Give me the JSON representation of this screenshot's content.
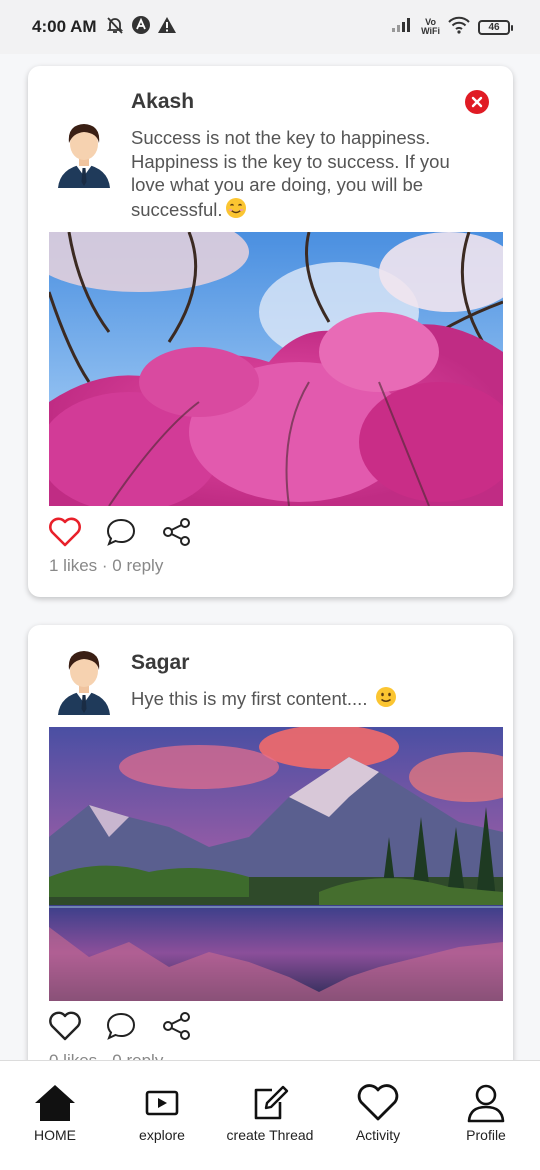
{
  "status": {
    "time": "4:00 AM",
    "wifi_label_top": "Vo",
    "wifi_label_bottom": "WiFi",
    "battery": "46"
  },
  "posts": [
    {
      "author": "Akash",
      "content": "Success is not the key to happiness. Happiness is the key to success. If you love what you are doing, you will be successful.",
      "emoji": "smiling-face-icon",
      "image": "pink-blossom-tree-photo",
      "liked": true,
      "meta": "1 likes · 0 reply"
    },
    {
      "author": "Sagar",
      "content": "Hye this is my first content.... ",
      "emoji": "slightly-smiling-face-icon",
      "image": "mountain-lake-sunset-photo",
      "liked": false,
      "meta": "0 likes · 0 reply"
    }
  ],
  "nav": {
    "home": "HOME",
    "explore": "explore",
    "create": "create Thread",
    "activity": "Activity",
    "profile": "Profile"
  },
  "colors": {
    "like_active": "#e8202a",
    "close": "#e01b24",
    "background": "#f6f7f9"
  }
}
